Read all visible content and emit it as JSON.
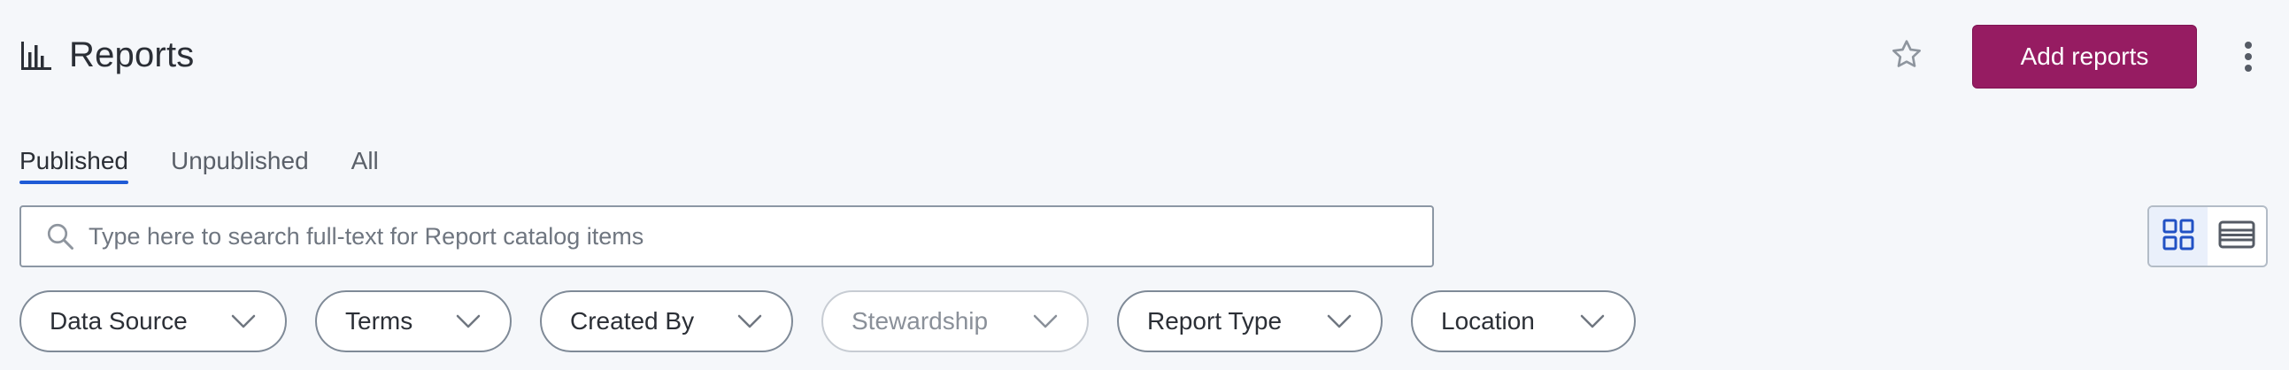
{
  "header": {
    "icon": "bar-chart-icon",
    "title": "Reports"
  },
  "actions": {
    "favorite_icon": "star-icon",
    "add_label": "Add reports",
    "more_icon": "kebab-menu-icon",
    "primary_color": "#961c62"
  },
  "tabs": [
    {
      "label": "Published",
      "active": true
    },
    {
      "label": "Unpublished",
      "active": false
    },
    {
      "label": "All",
      "active": false
    }
  ],
  "search": {
    "icon": "search-icon",
    "value": "",
    "placeholder": "Type here to search full-text for Report catalog items"
  },
  "view_toggle": {
    "options": [
      {
        "icon": "grid-view-icon",
        "active": true
      },
      {
        "icon": "list-view-icon",
        "active": false
      }
    ]
  },
  "filters": [
    {
      "label": "Data Source",
      "enabled": true
    },
    {
      "label": "Terms",
      "enabled": true
    },
    {
      "label": "Created By",
      "enabled": true
    },
    {
      "label": "Stewardship",
      "enabled": false
    },
    {
      "label": "Report Type",
      "enabled": true
    },
    {
      "label": "Location",
      "enabled": true
    }
  ],
  "colors": {
    "accent_tab": "#1f5bd6",
    "background": "#f5f7fa"
  }
}
